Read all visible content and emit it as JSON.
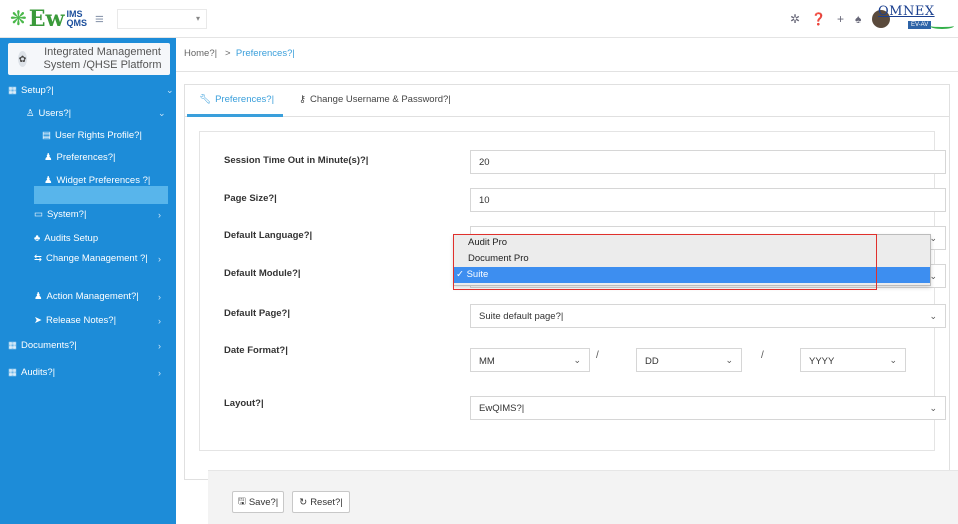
{
  "app": {
    "logo_main": "Ew",
    "logo_ims": "IMS",
    "logo_qms": "QMS",
    "brand": "OMNEX",
    "brand_sub": "EV-AV",
    "header_title": "Integrated Management System /QHSE Platform"
  },
  "top_icons": [
    "gear-icon",
    "help-icon",
    "plus-icon",
    "bell-icon",
    "avatar"
  ],
  "sidebar": {
    "items": [
      {
        "label": "Setup?|",
        "icon": "grid-icon"
      },
      {
        "label": "Users?|",
        "icon": "user-icon"
      },
      {
        "label": "User Rights Profile?|",
        "icon": "id-card-icon"
      },
      {
        "label": "Preferences?|",
        "icon": "user-gear-icon"
      },
      {
        "label": "Widget Preferences ?|",
        "icon": "user-widget-icon"
      },
      {
        "label": "System?|",
        "icon": "monitor-icon"
      },
      {
        "label": "Audits Setup",
        "icon": "users-icon"
      },
      {
        "label": "Change Management ?|",
        "icon": "flow-icon"
      },
      {
        "label": "Action Management?|",
        "icon": "user-edit-icon"
      },
      {
        "label": "Release Notes?|",
        "icon": "send-icon"
      },
      {
        "label": "Documents?|",
        "icon": "grid-icon"
      },
      {
        "label": "Audits?|",
        "icon": "grid-icon"
      }
    ]
  },
  "breadcrumb": {
    "home": "Home?|",
    "separator": ">",
    "current": "Preferences?|"
  },
  "tabs": [
    {
      "label": "Preferences?|",
      "active": true
    },
    {
      "label": "Change Username & Password?|",
      "active": false
    }
  ],
  "form": {
    "session_label": "Session Time Out in Minute(s)?|",
    "session_value": "20",
    "page_size_label": "Page Size?|",
    "page_size_value": "10",
    "language_label": "Default Language?|",
    "module_label": "Default Module?|",
    "page_label": "Default Page?|",
    "page_value": "Suite default page?|",
    "date_label": "Date Format?|",
    "date_month": "MM",
    "date_day": "DD",
    "date_year": "YYYY",
    "date_sep": "/",
    "layout_label": "Layout?|",
    "layout_value": "EwQIMS?|"
  },
  "module_options": [
    {
      "label": "Audit Pro",
      "selected": false
    },
    {
      "label": "Document Pro",
      "selected": false
    },
    {
      "label": "✓ Suite",
      "selected": true
    }
  ],
  "buttons": {
    "save": "Save?|",
    "reset": "Reset?|"
  },
  "colors": {
    "sidebar": "#1d8cd8",
    "sidebar_active": "#58b5eb",
    "accent": "#3a9fdb",
    "highlight_box": "#e0302c",
    "selected_option": "#3d8ef0"
  }
}
